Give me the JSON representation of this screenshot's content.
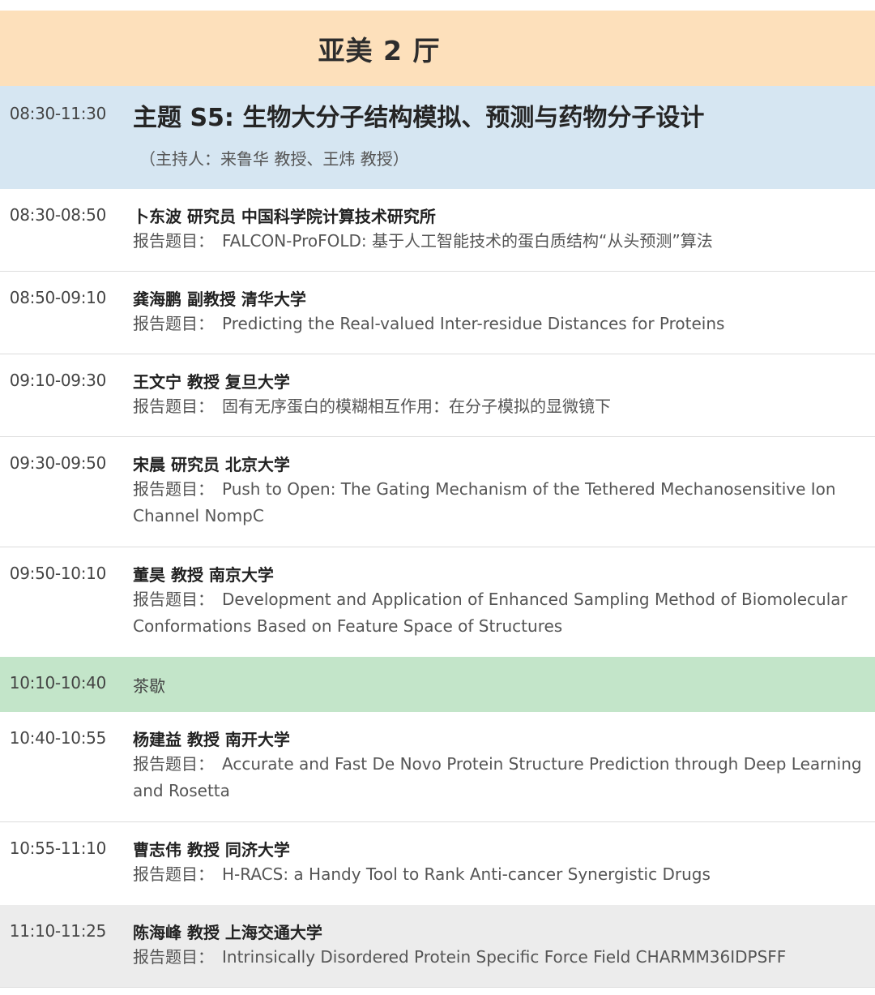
{
  "hall": {
    "title": "亚美 2 厅"
  },
  "session": {
    "time": "08:30-11:30",
    "title": "主题 S5: 生物大分子结构模拟、预测与药物分子设计",
    "moderator": "（主持人：来鲁华 教授、王炜 教授）"
  },
  "talk_prefix": "报告题目：",
  "talks": [
    {
      "time": "08:30-08:50",
      "speaker": "卜东波 研究员 中国科学院计算技术研究所",
      "title": "FALCON-ProFOLD: 基于人工智能技术的蛋白质结构“从头预测”算法"
    },
    {
      "time": "08:50-09:10",
      "speaker": "龚海鹏 副教授 清华大学",
      "title": "Predicting the Real-valued Inter-residue Distances for Proteins"
    },
    {
      "time": "09:10-09:30",
      "speaker": "王文宁 教授 复旦大学",
      "title": "固有无序蛋白的模糊相互作用：在分子模拟的显微镜下"
    },
    {
      "time": "09:30-09:50",
      "speaker": "宋晨 研究员 北京大学",
      "title": "Push to Open: The Gating Mechanism of the Tethered Mechanosensitive Ion Channel NompC"
    },
    {
      "time": "09:50-10:10",
      "speaker": "董昊 教授 南京大学",
      "title": "Development and Application of Enhanced Sampling Method of Biomolecular Conformations Based on Feature Space of Structures"
    },
    {
      "time": "10:40-10:55",
      "speaker": "杨建益 教授 南开大学",
      "title": "Accurate and Fast De Novo Protein Structure Prediction through Deep Learning and Rosetta"
    },
    {
      "time": "10:55-11:10",
      "speaker": "曹志伟 教授 同济大学",
      "title": "H-RACS: a Handy Tool to Rank Anti-cancer Synergistic Drugs"
    },
    {
      "time": "11:10-11:25",
      "speaker": "陈海峰 教授 上海交通大学",
      "title": "Intrinsically Disordered Protein Specific Force Field CHARMM36IDPSFF"
    }
  ],
  "break": {
    "time": "10:10-10:40",
    "label": "茶歇"
  },
  "colors": {
    "hall_header_bg": "#fde0bb",
    "session_bg": "#d6e6f2",
    "break_bg": "#c3e5c9",
    "last_row_bg": "#ececec"
  }
}
